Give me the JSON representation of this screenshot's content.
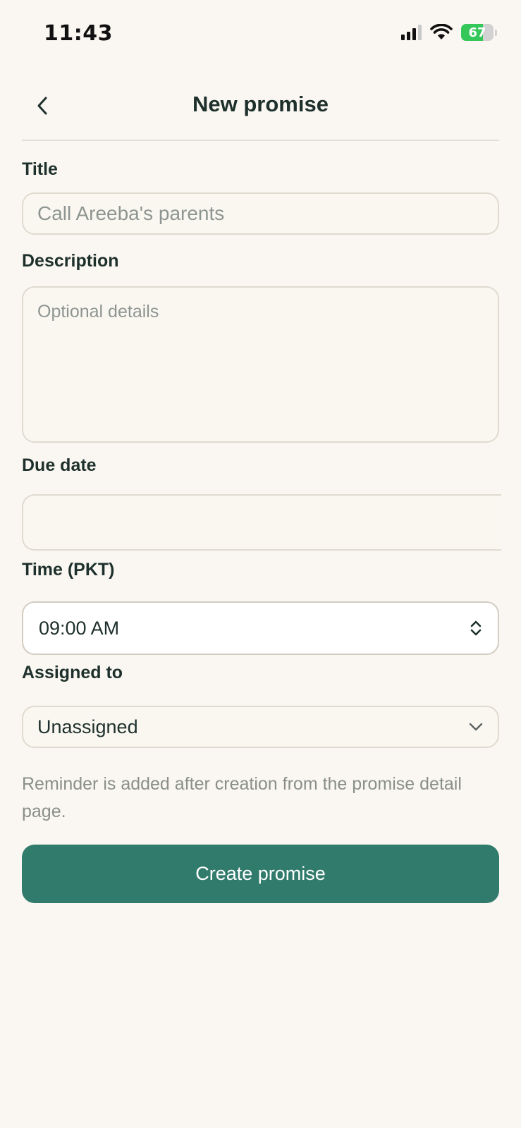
{
  "status_bar": {
    "time": "11:43",
    "battery_percent": "67",
    "battery_level": 0.67,
    "colors": {
      "battery_fill": "#35c759"
    }
  },
  "header": {
    "title": "New promise",
    "back_icon": "chevron-left-icon"
  },
  "form": {
    "title": {
      "label": "Title",
      "placeholder": "Call Areeba's parents",
      "value": ""
    },
    "description": {
      "label": "Description",
      "placeholder": "Optional details",
      "value": ""
    },
    "due_date": {
      "label": "Due date",
      "value": ""
    },
    "time": {
      "label": "Time (PKT)",
      "value": "09:00 AM",
      "icon": "chevron-up-down-icon"
    },
    "assigned_to": {
      "label": "Assigned to",
      "value": "Unassigned",
      "icon": "chevron-down-icon"
    },
    "helper_text": "Reminder is added after creation from the promise detail page.",
    "submit_label": "Create promise"
  },
  "colors": {
    "background": "#faf7f2",
    "primary_button": "#317b6c",
    "text": "#1e302c",
    "muted_text": "#8a8f8b"
  }
}
